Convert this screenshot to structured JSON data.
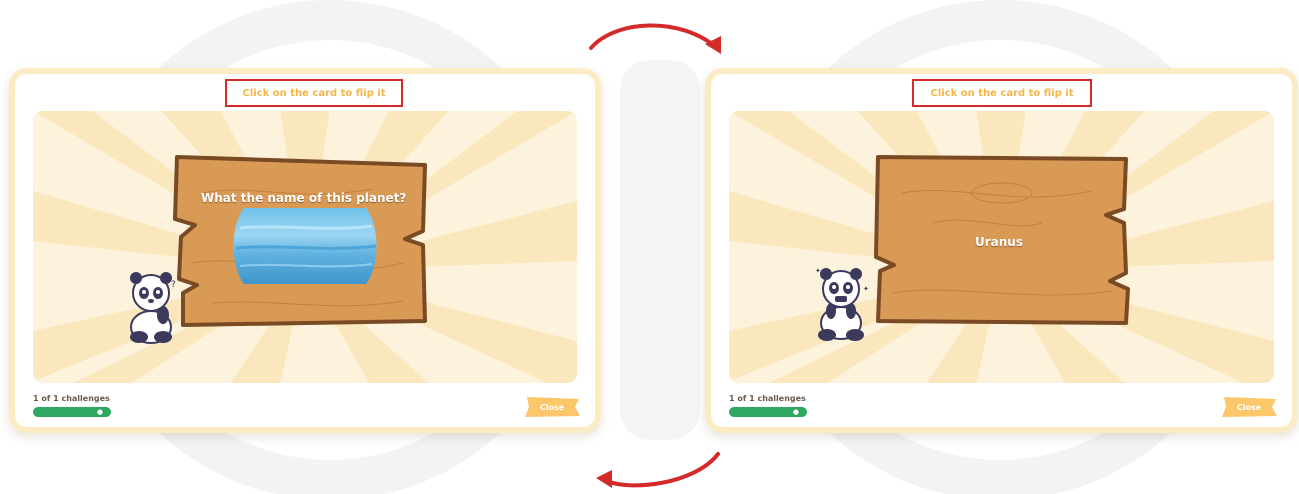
{
  "left_card": {
    "instruction": "Click on the card to flip it",
    "question": "What the name of this planet?",
    "progress_text": "1 of 1 challenges",
    "progress_value": 1.0,
    "close_label": "Close"
  },
  "right_card": {
    "instruction": "Click on the card to flip it",
    "answer": "Uranus",
    "progress_text": "1 of 1 challenges",
    "progress_value": 1.0,
    "close_label": "Close"
  },
  "colors": {
    "highlight_border": "#d42a2a",
    "instruction_text": "#f6b547",
    "wood": "#d99a55",
    "wood_border": "#7a4a25",
    "progress": "#38b46b",
    "close_button": "#fbc76a",
    "panel_border": "#fbecc6",
    "flip_arrow": "#d42a2a"
  },
  "icons": {
    "flip_forward": "curved-arrow-icon",
    "flip_back": "curved-arrow-icon",
    "progress_marker": "paw-icon",
    "mascot": "panda-illustration",
    "planet": "uranus-image"
  }
}
